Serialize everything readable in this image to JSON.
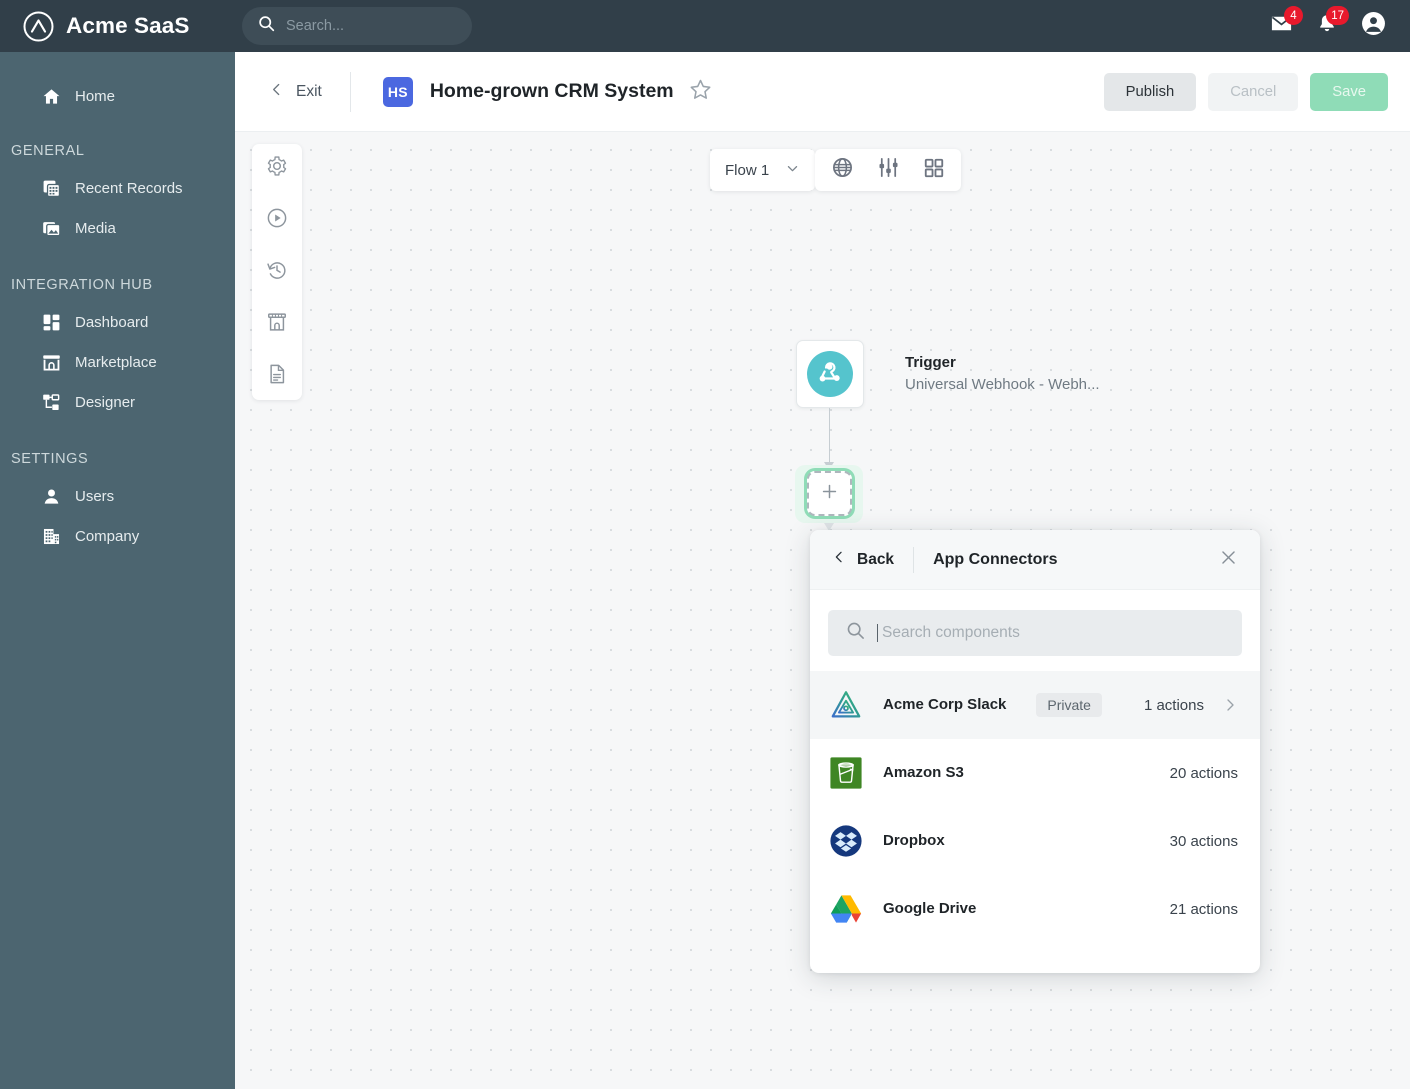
{
  "topbar": {
    "brand": "Acme SaaS",
    "logo_icon": "acme-circle-logo",
    "search": {
      "icon": "search-icon",
      "placeholder": "Search..."
    },
    "mail": {
      "icon": "mail-icon",
      "badge": "4"
    },
    "notifications": {
      "icon": "bell-icon",
      "badge": "17"
    },
    "account": {
      "icon": "account-circle-icon"
    },
    "colors": {
      "bar_bg": "#313f49",
      "badge": "#e8192c"
    }
  },
  "sidebar": {
    "bg": "#4c6570",
    "items": [
      {
        "label": "Home",
        "icon": "home-icon",
        "type": "item"
      },
      {
        "label": "GENERAL",
        "type": "section"
      },
      {
        "label": "Recent Records",
        "icon": "recent-records-icon",
        "type": "item"
      },
      {
        "label": "Media",
        "icon": "media-image-icon",
        "type": "item"
      },
      {
        "label": "INTEGRATION HUB",
        "type": "section"
      },
      {
        "label": "Dashboard",
        "icon": "dashboard-grid-icon",
        "type": "item"
      },
      {
        "label": "Marketplace",
        "icon": "marketplace-store-icon",
        "type": "item"
      },
      {
        "label": "Designer",
        "icon": "designer-nodes-icon",
        "type": "item"
      },
      {
        "label": "SETTINGS",
        "type": "section"
      },
      {
        "label": "Users",
        "icon": "user-icon",
        "type": "item"
      },
      {
        "label": "Company",
        "icon": "company-building-icon",
        "type": "item"
      }
    ]
  },
  "header": {
    "exit_label": "Exit",
    "exit_icon": "chevron-left-icon",
    "avatar_initials": "HS",
    "avatar_color": "#4b68e0",
    "title": "Home-grown CRM System",
    "star_icon": "star-outline-icon",
    "buttons": {
      "publish": "Publish",
      "cancel": "Cancel",
      "save": "Save"
    }
  },
  "canvas": {
    "tool_rail": [
      {
        "icon": "gear-icon"
      },
      {
        "icon": "play-circle-icon"
      },
      {
        "icon": "history-icon"
      },
      {
        "icon": "marketplace-store-icon"
      },
      {
        "icon": "document-icon"
      }
    ],
    "flow_select": {
      "label": "Flow 1",
      "icon": "chevron-down-icon"
    },
    "view_tools": [
      {
        "icon": "globe-icon"
      },
      {
        "icon": "sliders-icon"
      },
      {
        "icon": "grid-icon"
      }
    ],
    "trigger_node": {
      "icon": "webhook-icon",
      "icon_bg": "#55c4cd",
      "title": "Trigger",
      "subtitle": "Universal Webhook - Webh..."
    },
    "add_node": {
      "icon": "plus-icon",
      "highlight_color": "#8fdcb7"
    }
  },
  "panel": {
    "back_label": "Back",
    "back_icon": "chevron-left-icon",
    "title": "App Connectors",
    "close_icon": "close-icon",
    "search": {
      "icon": "search-icon",
      "placeholder": "Search components",
      "value": ""
    },
    "connectors": [
      {
        "name": "Acme Corp Slack",
        "icon": "acme-corp-slack-icon",
        "tag": "Private",
        "actions": "1 actions",
        "chevron": "chevron-right-icon",
        "hovered": true
      },
      {
        "name": "Amazon S3",
        "icon": "amazon-s3-icon",
        "tag": "",
        "actions": "20 actions",
        "chevron": "",
        "hovered": false
      },
      {
        "name": "Dropbox",
        "icon": "dropbox-icon",
        "tag": "",
        "actions": "30 actions",
        "chevron": "",
        "hovered": false
      },
      {
        "name": "Google Drive",
        "icon": "google-drive-icon",
        "tag": "",
        "actions": "21 actions",
        "chevron": "",
        "hovered": false
      }
    ]
  }
}
